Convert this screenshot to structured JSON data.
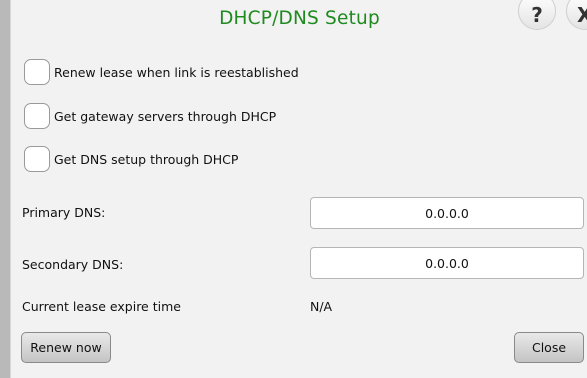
{
  "dialog": {
    "title": "DHCP/DNS Setup",
    "help_icon": "?",
    "close_icon": "X"
  },
  "options": [
    {
      "label": "Renew lease when link is reestablished",
      "checked": false
    },
    {
      "label": "Get gateway servers through DHCP",
      "checked": false
    },
    {
      "label": "Get DNS setup through DHCP",
      "checked": false
    }
  ],
  "dns": {
    "primary_label": "Primary DNS:",
    "primary_value": "0.0.0.0",
    "secondary_label": "Secondary DNS:",
    "secondary_value": "0.0.0.0"
  },
  "lease": {
    "label": "Current lease expire time",
    "value": "N/A"
  },
  "buttons": {
    "renew": "Renew now",
    "close": "Close"
  },
  "colors": {
    "title": "#1f8a1f",
    "background": "#f2f2f2"
  }
}
